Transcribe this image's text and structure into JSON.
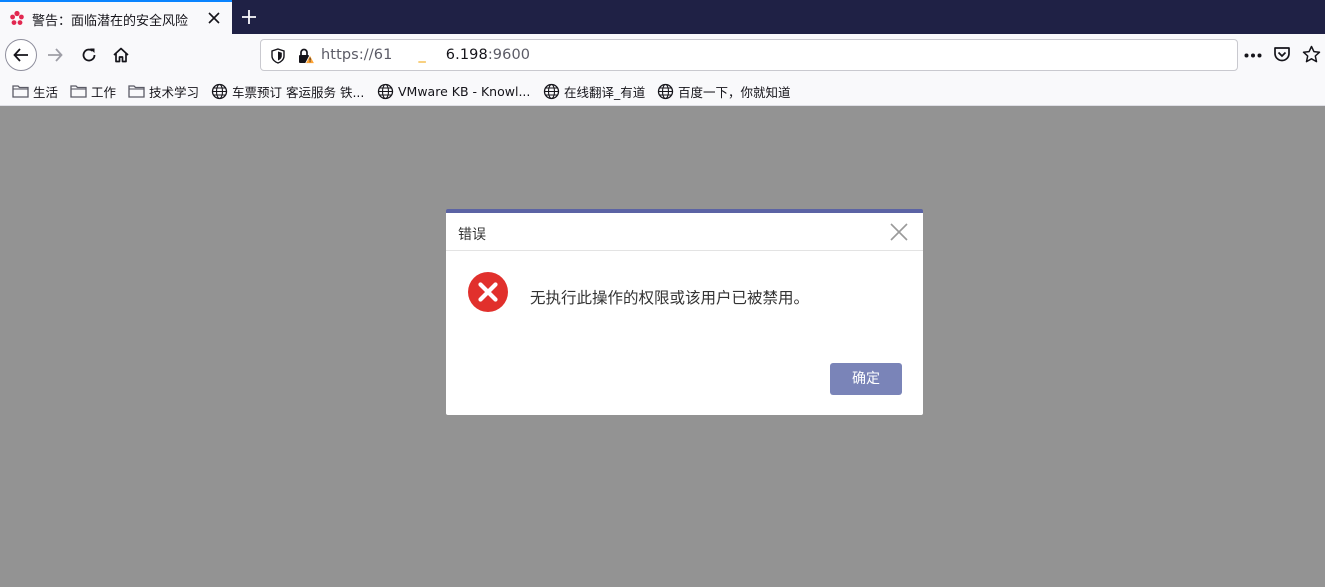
{
  "tab": {
    "title": "警告：面临潜在的安全风险"
  },
  "urlbar": {
    "url_prefix": "https://61",
    "url_mid": "_",
    "url_host": "6.198",
    "url_port": ":9600"
  },
  "bookmarks": [
    {
      "label": "生活",
      "icon": "folder-icon"
    },
    {
      "label": "工作",
      "icon": "folder-icon"
    },
    {
      "label": "技术学习",
      "icon": "folder-icon"
    },
    {
      "label": "车票预订 客运服务 铁...",
      "icon": "globe-icon"
    },
    {
      "label": "VMware KB - Knowl...",
      "icon": "globe-icon"
    },
    {
      "label": "在线翻译_有道",
      "icon": "globe-icon"
    },
    {
      "label": "百度一下，你就知道",
      "icon": "globe-icon"
    }
  ],
  "dialog": {
    "title": "错误",
    "message": "无执行此操作的权限或该用户已被禁用。",
    "ok_label": "确定"
  },
  "colors": {
    "tabstrip": "#1f2145",
    "overlay": "#939393",
    "dialog_accent": "#5b63a4",
    "ok_button": "#7a84b8",
    "error_red": "#e1302c"
  }
}
